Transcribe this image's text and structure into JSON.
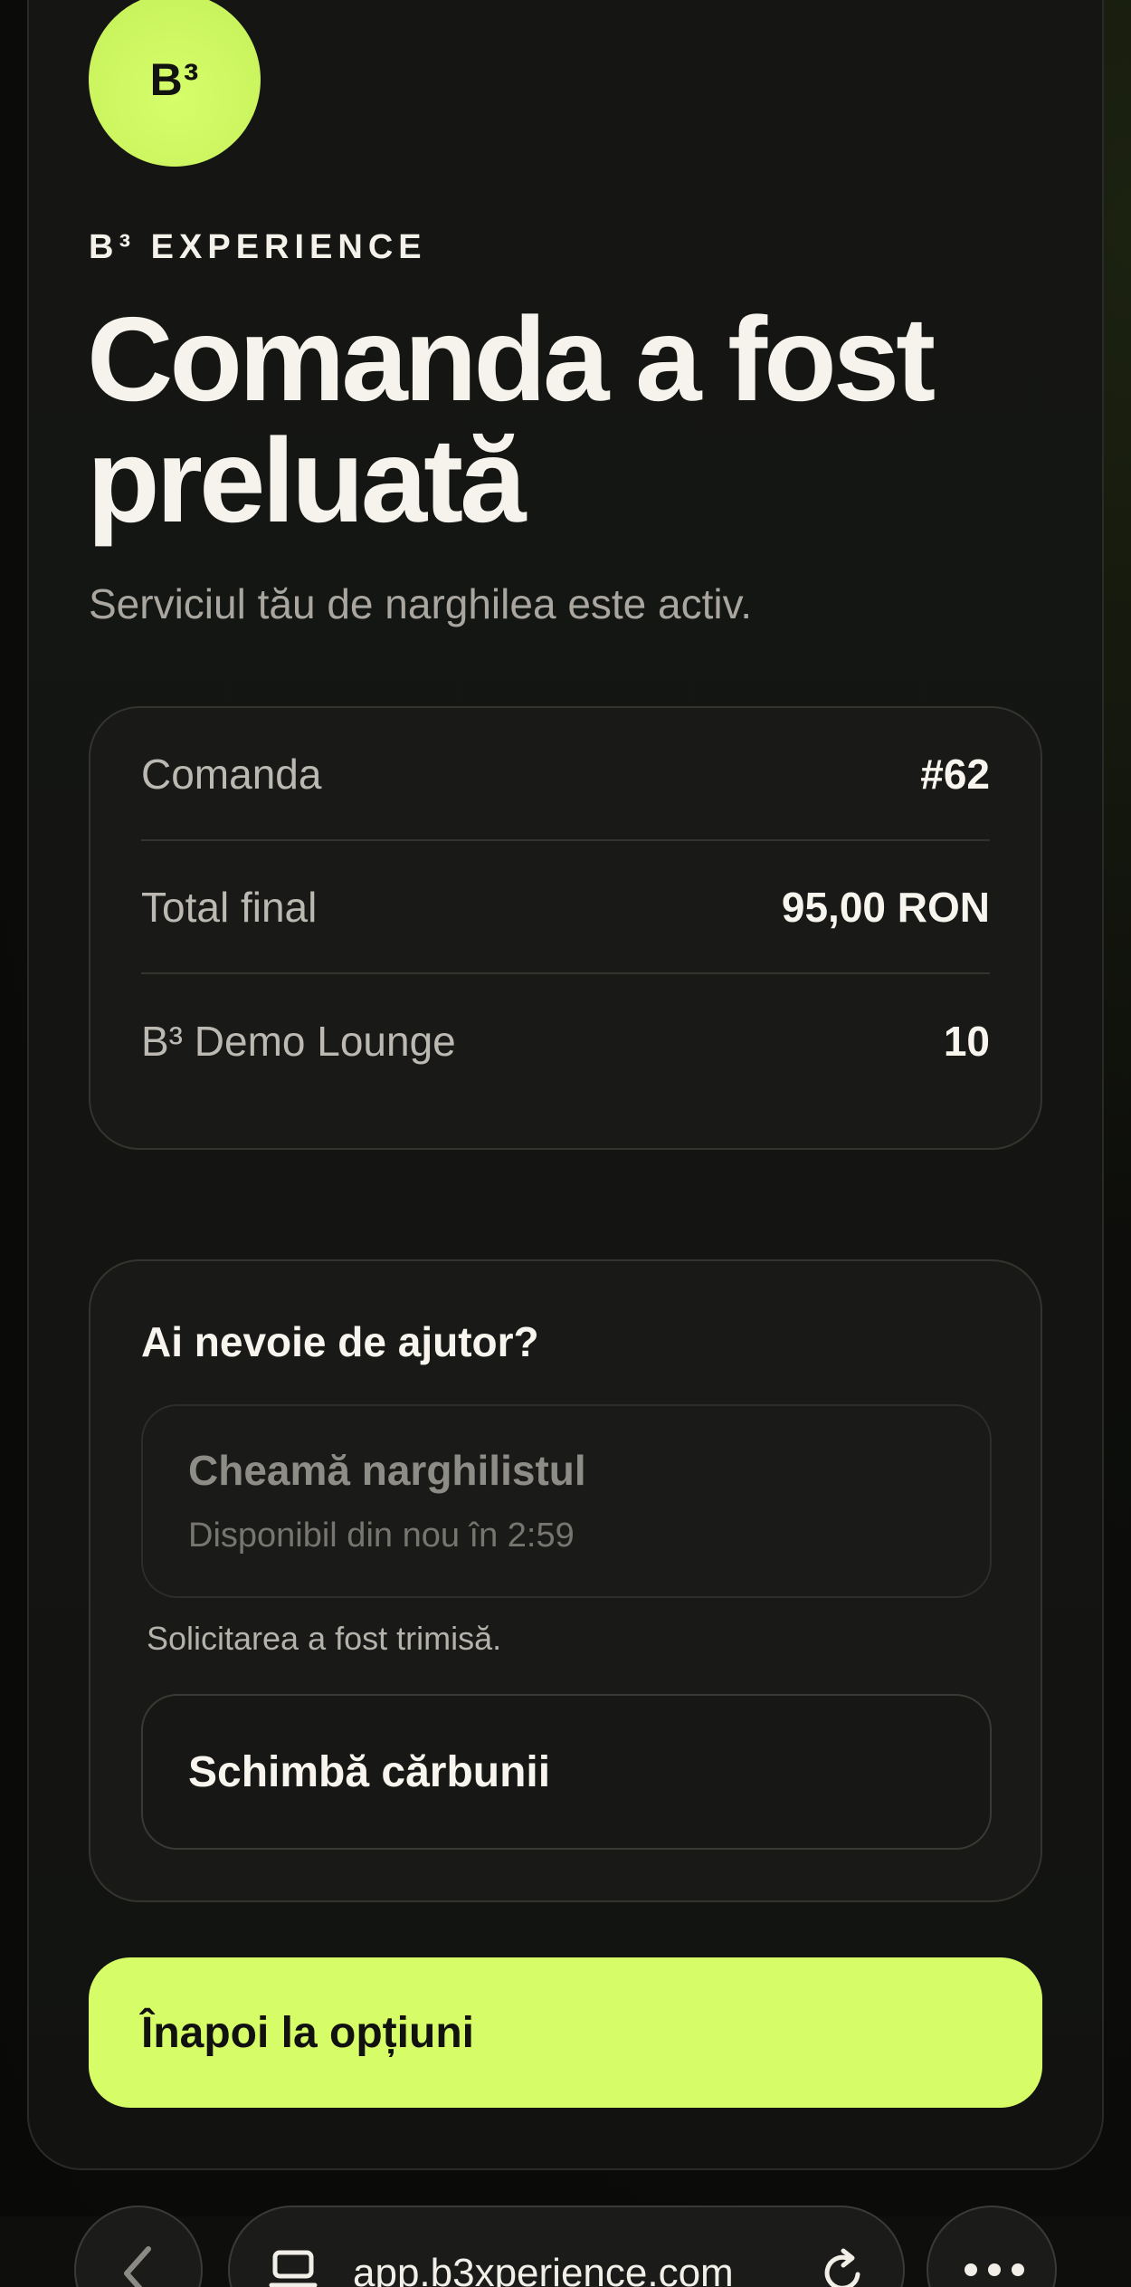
{
  "brand": {
    "logo_text": "B³",
    "eyebrow": "B³ EXPERIENCE",
    "accent_color": "#d6fd67"
  },
  "header": {
    "title_line1": "Comanda a fost",
    "title_line2": "preluată",
    "subtitle": "Serviciul tău de narghilea este activ."
  },
  "summary": {
    "rows": [
      {
        "label": "Comanda",
        "value": "#62"
      },
      {
        "label": "Total final",
        "value": "95,00 RON"
      },
      {
        "label": "B³ Demo Lounge",
        "value": "10"
      }
    ]
  },
  "help": {
    "title": "Ai nevoie de ajutor?",
    "call_button": {
      "label": "Cheamă narghilistul",
      "sublabel": "Disponibil din nou în 2:59"
    },
    "sent_note": "Solicitarea a fost trimisă.",
    "coal_button": "Schimbă cărbunii"
  },
  "back_button": "Înapoi la opțiuni",
  "browser": {
    "url": "app.b3xperience.com",
    "icons": [
      "chevron-left-icon",
      "tabs-icon",
      "reload-icon",
      "more-icon"
    ]
  }
}
